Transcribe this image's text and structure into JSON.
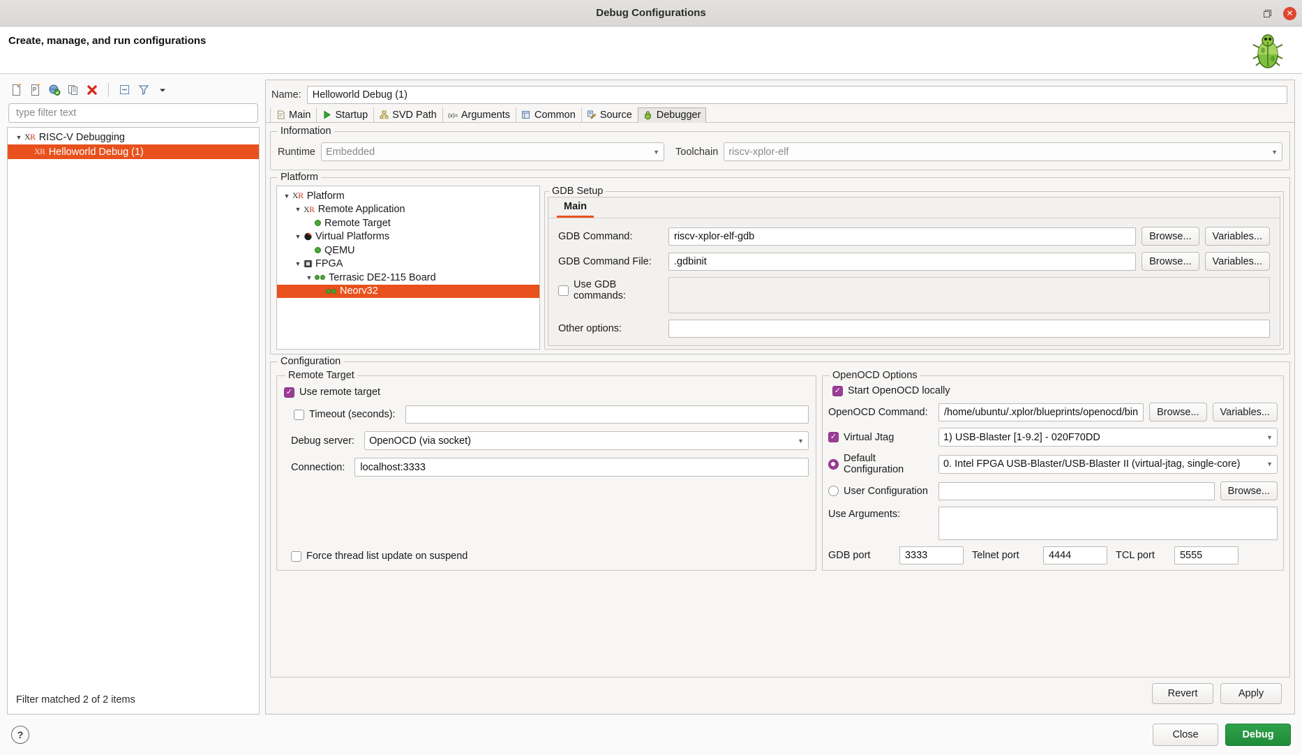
{
  "window": {
    "title": "Debug Configurations",
    "restore_icon": "restore-icon",
    "close_icon": "close-icon"
  },
  "header": {
    "headline": "Create, manage, and run configurations",
    "logo_icon": "bug-icon"
  },
  "left": {
    "toolbar": [
      {
        "name": "new-configuration-icon",
        "label": "New launch configuration"
      },
      {
        "name": "new-prototype-icon",
        "label": "New prototype"
      },
      {
        "name": "export-icon",
        "label": "Export"
      },
      {
        "name": "duplicate-icon",
        "label": "Duplicate"
      },
      {
        "name": "delete-icon",
        "label": "Delete"
      },
      {
        "name": "collapse-all-icon",
        "label": "Collapse All"
      },
      {
        "name": "filter-icon",
        "label": "Filter launch configurations"
      },
      {
        "name": "view-menu-icon",
        "label": "View Menu"
      }
    ],
    "filter": {
      "placeholder": "type filter text",
      "value": ""
    },
    "tree": [
      {
        "label": "RISC-V Debugging",
        "icon": "xr-icon",
        "expanded": true,
        "selected": false,
        "indent": 0
      },
      {
        "label": "Helloworld Debug (1)",
        "icon": "xr-icon",
        "expanded": false,
        "selected": true,
        "indent": 1
      }
    ],
    "status": "Filter matched 2 of 2 items"
  },
  "right": {
    "name_label": "Name:",
    "name_value": "Helloworld Debug (1)",
    "tabs": [
      {
        "label": "Main",
        "icon": "document-icon",
        "active": false
      },
      {
        "label": "Startup",
        "icon": "play-icon",
        "active": false
      },
      {
        "label": "SVD Path",
        "icon": "tree-icon",
        "active": false
      },
      {
        "label": "Arguments",
        "icon": "variable-icon",
        "active": false
      },
      {
        "label": "Common",
        "icon": "table-icon",
        "active": false
      },
      {
        "label": "Source",
        "icon": "source-icon",
        "active": false
      },
      {
        "label": "Debugger",
        "icon": "bug-icon",
        "active": true
      }
    ],
    "information": {
      "legend": "Information",
      "runtime_label": "Runtime",
      "runtime_value": "Embedded",
      "toolchain_label": "Toolchain",
      "toolchain_value": "riscv-xplor-elf"
    },
    "platform": {
      "legend": "Platform",
      "tree": [
        {
          "label": "Platform",
          "icon": "xr-icon",
          "expanded": true,
          "indent": 0,
          "selected": false
        },
        {
          "label": "Remote Application",
          "icon": "xr-icon",
          "expanded": true,
          "indent": 1,
          "selected": false
        },
        {
          "label": "Remote Target",
          "icon": "green-dot-icon",
          "expanded": null,
          "indent": 2,
          "selected": false
        },
        {
          "label": "Virtual Platforms",
          "icon": "qemu-icon",
          "expanded": true,
          "indent": 1,
          "selected": false
        },
        {
          "label": "QEMU",
          "icon": "green-dot-icon",
          "expanded": null,
          "indent": 2,
          "selected": false
        },
        {
          "label": "FPGA",
          "icon": "chip-icon",
          "expanded": true,
          "indent": 1,
          "selected": false
        },
        {
          "label": "Terrasic DE2-115 Board",
          "icon": "double-green-dot-icon",
          "expanded": true,
          "indent": 2,
          "selected": false
        },
        {
          "label": "Neorv32",
          "icon": "double-green-dot-icon",
          "expanded": null,
          "indent": 3,
          "selected": true
        }
      ]
    },
    "gdb_setup": {
      "legend": "GDB Setup",
      "tabs": [
        {
          "label": "Main",
          "active": true
        }
      ],
      "gdb_command_label": "GDB Command:",
      "gdb_command_value": "riscv-xplor-elf-gdb",
      "gdb_command_browse": "Browse...",
      "gdb_command_variables": "Variables...",
      "gdb_file_label": "GDB Command File:",
      "gdb_file_value": ".gdbinit",
      "gdb_file_browse": "Browse...",
      "gdb_file_variables": "Variables...",
      "use_gdb_commands_label": "Use GDB commands:",
      "use_gdb_commands_checked": false,
      "use_gdb_commands_value": "",
      "other_options_label": "Other options:",
      "other_options_value": ""
    },
    "configuration": {
      "legend": "Configuration",
      "remote_target": {
        "legend": "Remote Target",
        "use_remote_target_label": "Use remote target",
        "use_remote_target_checked": true,
        "timeout_label": "Timeout (seconds):",
        "timeout_checked": false,
        "timeout_value": "",
        "debug_server_label": "Debug server:",
        "debug_server_value": "OpenOCD (via socket)",
        "connection_label": "Connection:",
        "connection_value": "localhost:3333",
        "force_thread_label": "Force thread list update on suspend",
        "force_thread_checked": false
      },
      "openocd": {
        "legend": "OpenOCD Options",
        "start_locally_label": "Start OpenOCD locally",
        "start_locally_checked": true,
        "command_label": "OpenOCD Command:",
        "command_value": "/home/ubuntu/.xplor/blueprints/openocd/bin",
        "command_browse": "Browse...",
        "command_variables": "Variables...",
        "virtual_jtag_label": "Virtual Jtag",
        "virtual_jtag_checked": true,
        "virtual_jtag_value": "1) USB-Blaster [1-9.2] - 020F70DD",
        "default_config_label": "Default Configuration",
        "default_config_selected": true,
        "default_config_value": "0. Intel FPGA USB-Blaster/USB-Blaster II (virtual-jtag, single-core)",
        "user_config_label": "User Configuration",
        "user_config_selected": false,
        "user_config_value": "",
        "user_config_browse": "Browse...",
        "use_arguments_label": "Use Arguments:",
        "use_arguments_value": "",
        "gdb_port_label": "GDB port",
        "gdb_port_value": "3333",
        "telnet_port_label": "Telnet port",
        "telnet_port_value": "4444",
        "tcl_port_label": "TCL port",
        "tcl_port_value": "5555"
      }
    },
    "revert_label": "Revert",
    "apply_label": "Apply"
  },
  "bottom": {
    "help_icon": "help-icon",
    "close_label": "Close",
    "debug_label": "Debug"
  },
  "colors": {
    "accent_orange": "#e8511d",
    "checkbox_purple": "#9a3d96",
    "debug_green": "#2fa24a",
    "close_red": "#e0452e"
  }
}
